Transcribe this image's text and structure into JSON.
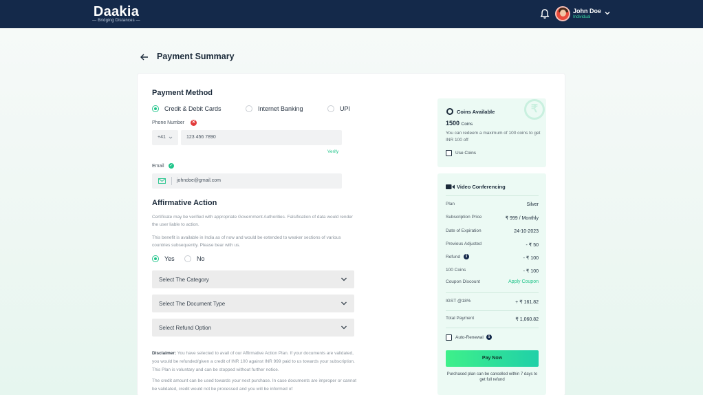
{
  "header": {
    "brand": "Daakia",
    "tagline": "— Bridging Distances —",
    "user_name": "John Doe",
    "user_role": "Individual"
  },
  "page": {
    "title": "Payment Summary"
  },
  "payment_method": {
    "title": "Payment Method",
    "options": [
      "Credit & Debit Cards",
      "Internet Banking",
      "UPI"
    ],
    "selected": "Credit & Debit Cards",
    "phone_label": "Phone Number",
    "country_code": "+41",
    "phone_value": "123 456 7890",
    "verify_label": "Verify",
    "email_label": "Email",
    "email_value": "johndoe@gmail.com"
  },
  "affirmative": {
    "title": "Affirmative Action",
    "para1": "Certificate may be verified with appropriate Government Authorities. Falsification of data would render the user liable to action.",
    "para2": "This benefit is available in India as of now and would be extended to weaker sections of various countries subsequently. Please bear with us.",
    "yes_label": "Yes",
    "no_label": "No",
    "selected": "Yes",
    "category_placeholder": "Select The Category",
    "document_placeholder": "Select The Document Type",
    "refund_placeholder": "Select Refund Option",
    "disclaimer_label": "Disclaimer:",
    "disclaimer_text": "You have selected to avail of our Affirmative Action Plan. If your documents are validated, you would be refunded/given a credit of INR 100 against INR 999 paid to us towards your subscription. This Plan is voluntary and can be stopped without further notice.",
    "disclaimer_text2": "The credit amount can be used towards your next purchase. In case documents are improper or cannot be validated, credit would not be processed and you will be informed of"
  },
  "coins": {
    "title": "Coins Available",
    "amount": "1500",
    "unit": "Coins",
    "note": "You can redeem a maximum of 100 coins to get INR 100 off",
    "use_label": "Use Coins"
  },
  "summary": {
    "title": "Video Conferencing",
    "rows": [
      {
        "label": "Plan",
        "value": "Silver"
      },
      {
        "label": "Subscription Price",
        "value": "₹ 999 / Monthly"
      },
      {
        "label": "Date of Expiration",
        "value": "24-10-2023"
      },
      {
        "label": "Previous Adjusted",
        "value": "- ₹ 50"
      },
      {
        "label": "Refund",
        "value": "- ₹ 100"
      },
      {
        "label": "100 Coins",
        "value": "- ₹ 100"
      },
      {
        "label": "Coupon Discount",
        "value": "Apply Coupon"
      }
    ],
    "igst_label": "IGST @18%",
    "igst_value": "+ ₹ 161.82",
    "total_label": "Total Payment",
    "total_value": "₹ 1,060.82",
    "auto_renewal_label": "Auto-Renewal",
    "pay_label": "Pay Now",
    "footnote": "Purchased plan can be cancelled within 7 days to get full refund"
  },
  "colors": {
    "header_bg": "#14294a",
    "accent": "#22c58b",
    "panel_bg": "#ecfaf4",
    "error": "#e23b3b"
  }
}
